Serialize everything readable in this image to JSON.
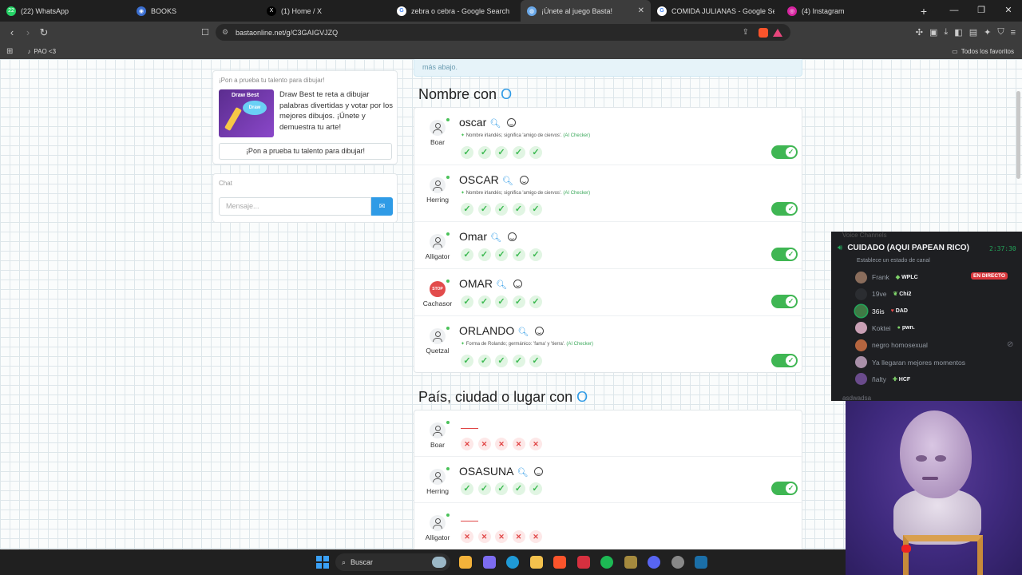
{
  "browser": {
    "tabs": [
      {
        "label": "(22) WhatsApp",
        "icon": "whatsapp-icon",
        "color": "#25d366",
        "glyph": "22"
      },
      {
        "label": "BOOKS",
        "icon": "books-site-icon",
        "color": "#3b6fd1",
        "glyph": "◉"
      },
      {
        "label": "(1) Home / X",
        "icon": "x-icon",
        "color": "#000000",
        "glyph": "X"
      },
      {
        "label": "zebra o cebra - Google Search",
        "icon": "google-icon",
        "color": "#ffffff",
        "glyph": "G"
      },
      {
        "label": "¡Únete al juego Basta!",
        "icon": "basta-icon",
        "color": "#6aa8e8",
        "glyph": "◍"
      },
      {
        "label": "COMIDA JULIANAS - Google Search",
        "icon": "google-icon",
        "color": "#ffffff",
        "glyph": "G"
      },
      {
        "label": "(4) Instagram",
        "icon": "instagram-icon",
        "color": "#d6249f",
        "glyph": "◎"
      }
    ],
    "active_tab_index": 4,
    "url": "bastaonline.net/g/C3GAIGVJZQ",
    "bookmark": "PAO <3",
    "all_favorites": "Todos los favoritos"
  },
  "sidebar": {
    "promo": {
      "title": "¡Pon a prueba tu talento para dibujar!",
      "image_title": "Draw Best",
      "image_badge": "Draw",
      "description": "Draw Best te reta a dibujar palabras divertidas y votar por los mejores dibujos. ¡Únete y demuestra tu arte!",
      "button": "¡Pon a prueba tu talento para dibujar!"
    },
    "chat": {
      "title": "Chat",
      "placeholder": "Mensaje..."
    }
  },
  "main": {
    "top_note": "más abajo.",
    "sections": [
      {
        "heading": "Nombre con",
        "letter": "O",
        "rows": [
          {
            "user": "Boar",
            "word": "oscar",
            "definition": "Nombre irlandés; significa 'amigo de ciervos'.",
            "ai": "(AI Checker)",
            "votes": [
              "check",
              "check",
              "check",
              "check",
              "check"
            ],
            "valid": true
          },
          {
            "user": "Herring",
            "word": "OSCAR",
            "definition": "Nombre irlandés; significa 'amigo de ciervos'.",
            "ai": "(AI Checker)",
            "votes": [
              "check",
              "check",
              "check",
              "check",
              "check"
            ],
            "valid": true
          },
          {
            "user": "Alligator",
            "word": "Omar",
            "definition": "",
            "ai": "",
            "votes": [
              "check",
              "check",
              "check",
              "check",
              "check"
            ],
            "valid": true
          },
          {
            "user": "Cachasor",
            "word": "OMAR",
            "definition": "",
            "ai": "",
            "votes": [
              "check",
              "check",
              "check",
              "check",
              "check"
            ],
            "valid": true,
            "stop": true
          },
          {
            "user": "Quetzal",
            "word": "ORLANDO",
            "definition": "Forma de Rolando; germánico: 'fama' y 'tierra'.",
            "ai": "(AI Checker)",
            "votes": [
              "check",
              "check",
              "check",
              "check",
              "check"
            ],
            "valid": true
          }
        ]
      },
      {
        "heading": "País, ciudad o lugar con",
        "letter": "O",
        "rows": [
          {
            "user": "Boar",
            "word": "",
            "definition": "",
            "ai": "",
            "votes": [
              "x",
              "x",
              "x",
              "x",
              "x"
            ],
            "valid": false
          },
          {
            "user": "Herring",
            "word": "OSASUNA",
            "definition": "",
            "ai": "",
            "votes": [
              "check",
              "check",
              "check",
              "check",
              "check"
            ],
            "valid": true
          },
          {
            "user": "Alligator",
            "word": "",
            "definition": "",
            "ai": "",
            "votes": [
              "x",
              "x",
              "x",
              "x",
              "x"
            ],
            "valid": false
          }
        ]
      }
    ]
  },
  "discord": {
    "above": "Voice Channels",
    "channel": "CUIDADO (AQUI PAPEAN RICO)",
    "timer": "2:37:30",
    "status": "Establece un estado de canal",
    "live_badge": "EN DIRECTO",
    "users": [
      {
        "name": "Frank",
        "tag": "WPLC",
        "tag_icon": "diamond",
        "avatar_color": "#8a6d5c"
      },
      {
        "name": "19ve",
        "tag": "Chi2",
        "tag_icon": "leaf",
        "avatar_color": "#2b2d31"
      },
      {
        "name": "36is",
        "tag": "DAD",
        "tag_icon": "heart",
        "avatar_color": "#3f7a45",
        "highlight": true
      },
      {
        "name": "Koktei",
        "tag": "pwn.",
        "tag_icon": "drop",
        "avatar_color": "#c9a0b5"
      },
      {
        "name": "negro homosexual",
        "tag": "",
        "tag_icon": "",
        "avatar_color": "#b5653f"
      },
      {
        "name": "Ya llegaran mejores momentos",
        "tag": "",
        "tag_icon": "",
        "avatar_color": "#a88fa8"
      },
      {
        "name": "ñalty",
        "tag": "HCF",
        "tag_icon": "sword",
        "avatar_color": "#6a4b8c"
      }
    ],
    "next_channel": "asdwadsa"
  },
  "taskbar": {
    "search": "Buscar",
    "apps": [
      {
        "icon": "file-explorer-alt-icon",
        "color": "#f3b23a"
      },
      {
        "icon": "copilot-icon",
        "color": "#7d6cf0"
      },
      {
        "icon": "edge-icon",
        "color": "#1f9ad6"
      },
      {
        "icon": "folder-icon",
        "color": "#f4c24d"
      },
      {
        "icon": "brave-icon",
        "color": "#fb542b"
      },
      {
        "icon": "red-app-icon",
        "color": "#d6303f"
      },
      {
        "icon": "spotify-icon",
        "color": "#1db954"
      },
      {
        "icon": "minecraft-icon",
        "color": "#a58a3e"
      },
      {
        "icon": "discord-icon",
        "color": "#5865f2"
      },
      {
        "icon": "gear-app-icon",
        "color": "#888888"
      },
      {
        "icon": "steam-icon",
        "color": "#1b6fa8"
      }
    ]
  }
}
